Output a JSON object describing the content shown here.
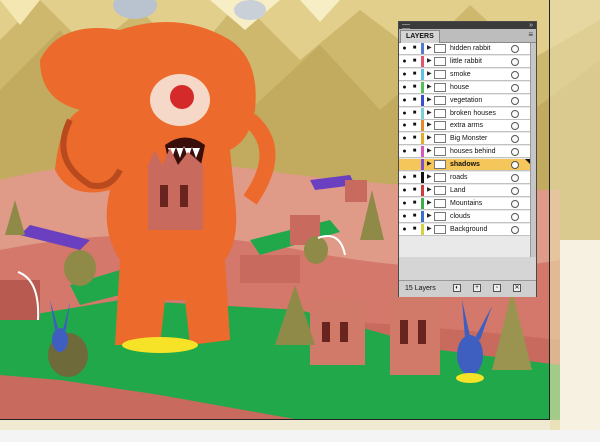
{
  "panel": {
    "tab_label": "LAYERS",
    "menu_icon": "panel-menu-icon",
    "collapse_glyph": "»",
    "layers": [
      {
        "name": "hidden rabbit",
        "color": "#4f7bd0",
        "visible": true,
        "locked": true,
        "selected": false
      },
      {
        "name": "little rabbit",
        "color": "#e0566e",
        "visible": true,
        "locked": true,
        "selected": false
      },
      {
        "name": "smoke",
        "color": "#5fc2e0",
        "visible": true,
        "locked": true,
        "selected": false
      },
      {
        "name": "house",
        "color": "#55c05a",
        "visible": true,
        "locked": true,
        "selected": false
      },
      {
        "name": "vegetation",
        "color": "#3a4fd0",
        "visible": true,
        "locked": true,
        "selected": false
      },
      {
        "name": "broken houses",
        "color": "#7ad0d8",
        "visible": true,
        "locked": true,
        "selected": false
      },
      {
        "name": "extra arms",
        "color": "#e58a2a",
        "visible": true,
        "locked": true,
        "selected": false
      },
      {
        "name": "Big Monster",
        "color": "#e3ac2a",
        "visible": true,
        "locked": true,
        "selected": false
      },
      {
        "name": "houses behind",
        "color": "#d85ab8",
        "visible": true,
        "locked": true,
        "selected": false
      },
      {
        "name": "shadows",
        "color": "#7b4fd0",
        "visible": false,
        "locked": false,
        "selected": true
      },
      {
        "name": "roads",
        "color": "#111111",
        "visible": true,
        "locked": true,
        "selected": false
      },
      {
        "name": "Land",
        "color": "#d03a3a",
        "visible": true,
        "locked": true,
        "selected": false
      },
      {
        "name": "Mountains",
        "color": "#3ab04a",
        "visible": true,
        "locked": true,
        "selected": false
      },
      {
        "name": "clouds",
        "color": "#3a6fd0",
        "visible": true,
        "locked": true,
        "selected": false
      },
      {
        "name": "Background",
        "color": "#d8d040",
        "visible": true,
        "locked": true,
        "selected": false
      }
    ],
    "footer": {
      "count": "15 Layers",
      "buttons": [
        "make-clipping-mask-icon",
        "new-sublayer-icon",
        "new-layer-icon",
        "delete-layer-icon"
      ]
    }
  }
}
